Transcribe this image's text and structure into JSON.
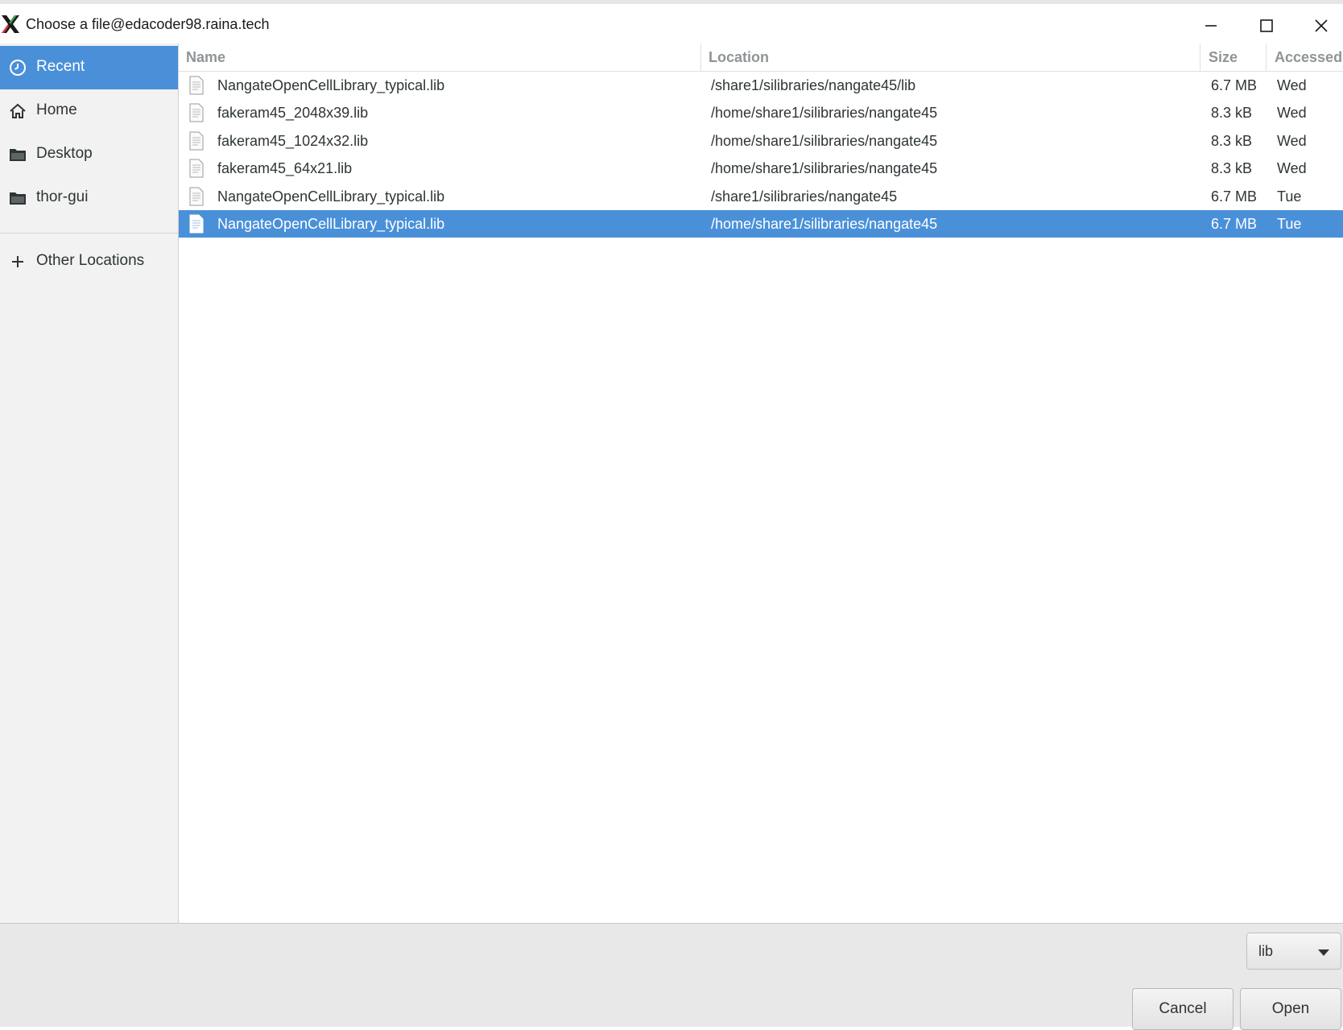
{
  "window": {
    "title": "Choose a file@edacoder98.raina.tech",
    "controls": [
      "minimize-icon",
      "maximize-icon",
      "close-icon"
    ]
  },
  "sidebar": {
    "items": [
      {
        "label": "Recent",
        "icon": "clock-icon",
        "active": true
      },
      {
        "label": "Home",
        "icon": "home-icon"
      },
      {
        "label": "Desktop",
        "icon": "folder-icon"
      },
      {
        "label": "thor-gui",
        "icon": "folder-icon"
      }
    ],
    "other": {
      "label": "Other Locations",
      "icon": "plus-icon"
    }
  },
  "filelist": {
    "columns": [
      "Name",
      "Location",
      "Size",
      "Accessed"
    ],
    "rows": [
      {
        "name": "NangateOpenCellLibrary_typical.lib",
        "location": "/share1/silibraries/nangate45/lib",
        "size": "6.7 MB",
        "accessed": "Wed",
        "selected": false
      },
      {
        "name": "fakeram45_2048x39.lib",
        "location": "/home/share1/silibraries/nangate45",
        "size": "8.3 kB",
        "accessed": "Wed",
        "selected": false
      },
      {
        "name": "fakeram45_1024x32.lib",
        "location": "/home/share1/silibraries/nangate45",
        "size": "8.3 kB",
        "accessed": "Wed",
        "selected": false
      },
      {
        "name": "fakeram45_64x21.lib",
        "location": "/home/share1/silibraries/nangate45",
        "size": "8.3 kB",
        "accessed": "Wed",
        "selected": false
      },
      {
        "name": "NangateOpenCellLibrary_typical.lib",
        "location": "/share1/silibraries/nangate45",
        "size": "6.7 MB",
        "accessed": "Tue",
        "selected": false
      },
      {
        "name": "NangateOpenCellLibrary_typical.lib",
        "location": "/home/share1/silibraries/nangate45",
        "size": "6.7 MB",
        "accessed": "Tue",
        "selected": true
      }
    ]
  },
  "footer": {
    "filter_value": "lib",
    "cancel_label": "Cancel",
    "open_label": "Open"
  },
  "colors": {
    "accent": "#4a90d9",
    "sidebar_bg": "#f2f2f2",
    "footer_bg": "#e8e8e8"
  }
}
